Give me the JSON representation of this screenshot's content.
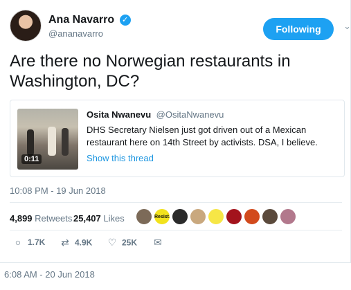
{
  "author": {
    "name": "Ana Navarro",
    "handle": "@ananavarro",
    "verified_icon": "✓"
  },
  "follow_label": "Following",
  "menu_icon": "⌄",
  "tweet_text": "Are there no Norwegian restaurants in Washington, DC?",
  "quoted": {
    "name": "Osita Nwanevu",
    "handle": "@OsitaNwanevu",
    "text": "DHS Secretary Nielsen just got driven out of a Mexican restaurant here on 14th Street by activists. DSA, I believe.",
    "video_duration": "0:11",
    "show_thread": "Show this thread"
  },
  "timestamp": "10:08 PM - 19 Jun 2018",
  "stats": {
    "retweets_count": "4,899",
    "retweets_label": "Retweets",
    "likes_count": "25,407",
    "likes_label": "Likes",
    "liker_badge_text": "Resist."
  },
  "actions": {
    "reply_count": "1.7K",
    "retweet_count": "4.9K",
    "like_count": "25K",
    "reply_icon": "○",
    "retweet_icon": "⇄",
    "like_icon": "♡",
    "dm_icon": "✉"
  },
  "colors": {
    "accent": "#1da1f2",
    "link": "#1b95e0",
    "muted": "#657786"
  },
  "footer_time": "6:08 AM - 20 Jun 2018"
}
